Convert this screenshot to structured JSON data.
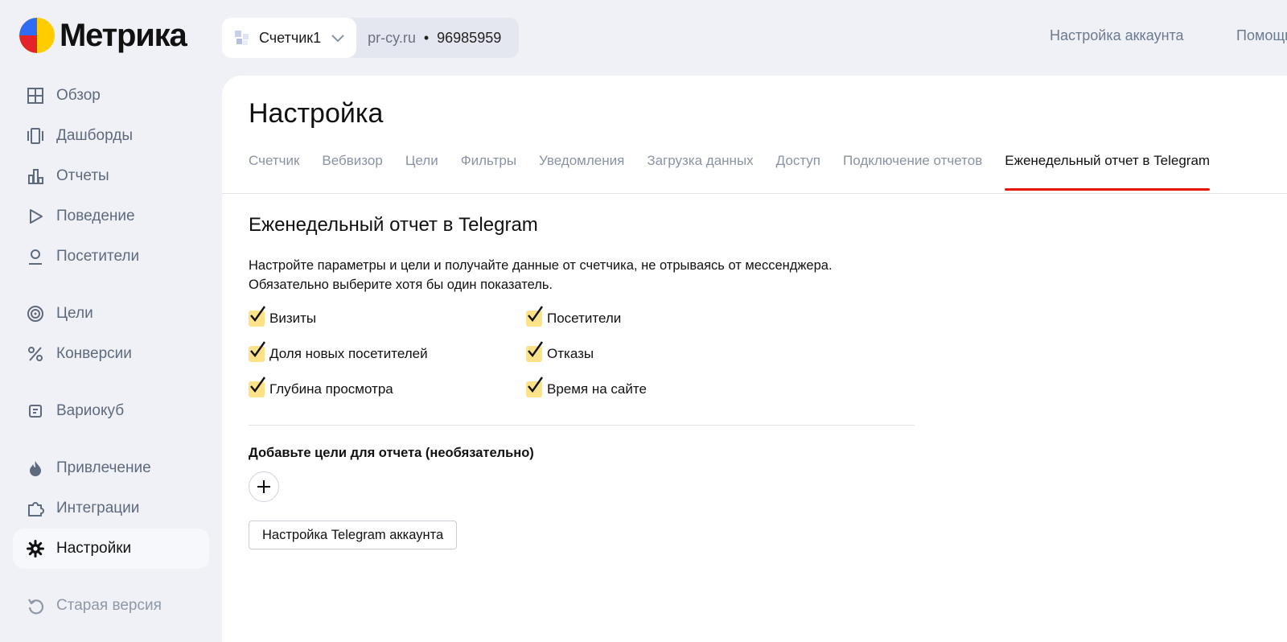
{
  "app": {
    "logo_text": "Метрика"
  },
  "counter": {
    "name": "Счетчик1",
    "site": "pr-cy.ru",
    "separator": "•",
    "id": "96985959"
  },
  "header": {
    "account_settings": "Настройка аккаунта",
    "help": "Помощь"
  },
  "sidebar": {
    "items": [
      {
        "label": "Обзор",
        "icon": "grid-icon"
      },
      {
        "label": "Дашборды",
        "icon": "dashboards-icon"
      },
      {
        "label": "Отчеты",
        "icon": "bar-chart-icon"
      },
      {
        "label": "Поведение",
        "icon": "play-icon"
      },
      {
        "label": "Посетители",
        "icon": "user-icon"
      },
      {
        "label": "Цели",
        "icon": "target-icon"
      },
      {
        "label": "Конверсии",
        "icon": "percent-icon"
      },
      {
        "label": "Вариокуб",
        "icon": "variocube-icon"
      },
      {
        "label": "Привлечение",
        "icon": "flame-icon"
      },
      {
        "label": "Интеграции",
        "icon": "puzzle-icon"
      },
      {
        "label": "Настройки",
        "icon": "gear-icon",
        "active": true
      },
      {
        "label": "Старая версия",
        "icon": "undo-icon"
      }
    ]
  },
  "main": {
    "title": "Настройка",
    "tabs": [
      {
        "label": "Счетчик"
      },
      {
        "label": "Вебвизор"
      },
      {
        "label": "Цели"
      },
      {
        "label": "Фильтры"
      },
      {
        "label": "Уведомления"
      },
      {
        "label": "Загрузка данных"
      },
      {
        "label": "Доступ"
      },
      {
        "label": "Подключение отчетов"
      },
      {
        "label": "Еженедельный отчет в Telegram",
        "active": true
      }
    ],
    "section_title": "Еженедельный отчет в Telegram",
    "description_line1": "Настройте параметры и цели и получайте данные от счетчика, не отрываясь от мессенджера.",
    "description_line2": "Обязательно выберите хотя бы один показатель.",
    "metrics": [
      {
        "label": "Визиты",
        "checked": true
      },
      {
        "label": "Посетители",
        "checked": true
      },
      {
        "label": "Доля новых посетителей",
        "checked": true
      },
      {
        "label": "Отказы",
        "checked": true
      },
      {
        "label": "Глубина просмотра",
        "checked": true
      },
      {
        "label": "Время на сайте",
        "checked": true
      }
    ],
    "goals_title": "Добавьте цели для отчета (необязательно)",
    "telegram_button": "Настройка Telegram аккаунта"
  },
  "colors": {
    "accent_red": "#e61400",
    "checkbox_yellow": "#fde28a",
    "sidebar_bg": "#f0f1f6"
  }
}
